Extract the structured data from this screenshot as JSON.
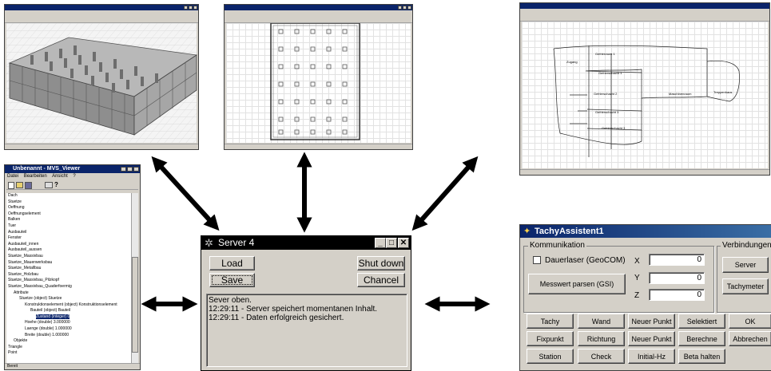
{
  "server": {
    "title": "Server 4",
    "load_label": "Load",
    "save_label": "Save",
    "shutdown_label": "Shut down",
    "cancel_label": "Chancel",
    "log": [
      "Sever oben.",
      "12:29:11 - Server speichert momentanen Inhalt.",
      "12:29:11 - Daten erfolgreich gesichert."
    ],
    "window_controls": [
      "minimize-icon",
      "maximize-icon",
      "close-icon"
    ]
  },
  "tachy": {
    "title": "TachyAssistent1",
    "group_communication": "Kommunikation",
    "group_connections": "Verbindungen",
    "checkbox_label": "Dauerlaser (GeoCOM)",
    "parse_button": "Messwert parsen (GSI)",
    "x_label": "X",
    "x_value": "0",
    "y_label": "Y",
    "y_value": "0",
    "z_label": "Z",
    "z_value": "0",
    "server_button": "Server",
    "tachymeter_button": "Tachymeter",
    "grid_buttons": [
      "Tachy",
      "Wand",
      "Neuer Punkt",
      "Selektiert",
      "OK",
      "Fixpunkt",
      "Richtung",
      "Neuer Punkt",
      "Berechne",
      "Abbrechen",
      "Station",
      "Check",
      "Initial-Hz",
      "Beta halten"
    ]
  },
  "mvs_viewer": {
    "title": "Unbenannt - MVS_Viewer",
    "menu": [
      "Datei",
      "Bearbeiten",
      "Ansicht",
      "?"
    ],
    "status": "Bereit",
    "tree": [
      {
        "text": "Dach",
        "indent": 0
      },
      {
        "text": "Stuetze",
        "indent": 0
      },
      {
        "text": "Oeffnung",
        "indent": 0
      },
      {
        "text": "Oeffnungselement",
        "indent": 0
      },
      {
        "text": "Balken",
        "indent": 0
      },
      {
        "text": "Tuer",
        "indent": 0
      },
      {
        "text": "Ausbauteil",
        "indent": 0
      },
      {
        "text": "Fenster",
        "indent": 0
      },
      {
        "text": "Ausbauteil_innen",
        "indent": 0
      },
      {
        "text": "Ausbauteil_aussen",
        "indent": 0
      },
      {
        "text": "Stuetze_Massivbau",
        "indent": 0
      },
      {
        "text": "Stuetze_Mauerwerksbau",
        "indent": 0
      },
      {
        "text": "Stuetze_Metallbau",
        "indent": 0
      },
      {
        "text": "Stuetze_Holzbau",
        "indent": 0
      },
      {
        "text": "Stuetze_Massivbau_Pilzkopf",
        "indent": 0
      },
      {
        "text": "Stuetze_Massivbau_Quaderfoermig",
        "indent": 0
      },
      {
        "text": "Attribute",
        "indent": 1
      },
      {
        "text": "Stuetze (object) Stuetze",
        "indent": 2
      },
      {
        "text": "Konstruktionselement (object) Konstruktionselement",
        "indent": 3
      },
      {
        "text": "Bauteil (object) Bauteil",
        "indent": 4
      },
      {
        "text": "Zustand (integer) 0",
        "indent": 5,
        "selected": true
      },
      {
        "text": "Hoehe (double) 3.000000",
        "indent": 3
      },
      {
        "text": "Laenge (double) 1.000000",
        "indent": 3
      },
      {
        "text": "Breite (double) 1.000000",
        "indent": 3
      },
      {
        "text": "Objekte",
        "indent": 1
      },
      {
        "text": "Triangle",
        "indent": 0
      },
      {
        "text": "Point",
        "indent": 0
      }
    ]
  },
  "sketch": {
    "rooms": [
      "Gefrierraum 1",
      "Zugang",
      "Gefrierschacht 1",
      "Gefrierschacht 2",
      "Maschinenraum",
      "Treppenhaus",
      "Gefrierschacht 3",
      "Gefrierschacht 3"
    ]
  },
  "colors": {
    "titlebar": "#0a246a",
    "titlebar_dark": "#000000",
    "window_face": "#d4d0c8",
    "arrow": "#000000"
  }
}
